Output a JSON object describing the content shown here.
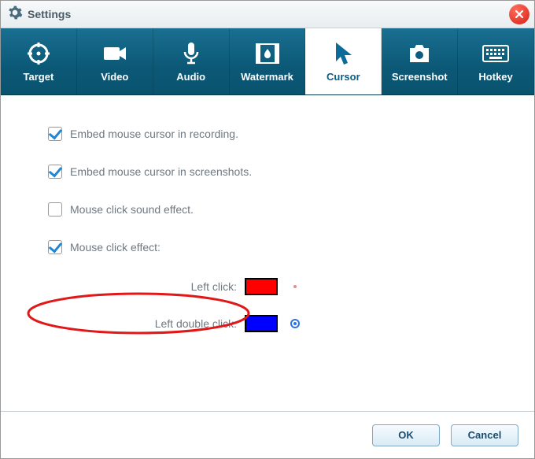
{
  "window": {
    "title": "Settings"
  },
  "tabs": [
    {
      "id": "target",
      "label": "Target"
    },
    {
      "id": "video",
      "label": "Video"
    },
    {
      "id": "audio",
      "label": "Audio"
    },
    {
      "id": "watermark",
      "label": "Watermark"
    },
    {
      "id": "cursor",
      "label": "Cursor"
    },
    {
      "id": "screenshot",
      "label": "Screenshot"
    },
    {
      "id": "hotkey",
      "label": "Hotkey"
    }
  ],
  "active_tab": "cursor",
  "options": {
    "embed_recording": {
      "label": "Embed mouse cursor in recording.",
      "checked": true
    },
    "embed_screenshots": {
      "label": "Embed mouse cursor in screenshots.",
      "checked": true
    },
    "click_sound": {
      "label": "Mouse click sound effect.",
      "checked": false
    },
    "click_effect": {
      "label": "Mouse click effect:",
      "checked": true
    }
  },
  "colors": {
    "left_click": {
      "label": "Left click:",
      "value": "#ff0000"
    },
    "left_double_click": {
      "label": "Left double click:",
      "value": "#0000ff"
    }
  },
  "buttons": {
    "ok": "OK",
    "cancel": "Cancel"
  },
  "annotation": {
    "highlight": "click_sound"
  }
}
